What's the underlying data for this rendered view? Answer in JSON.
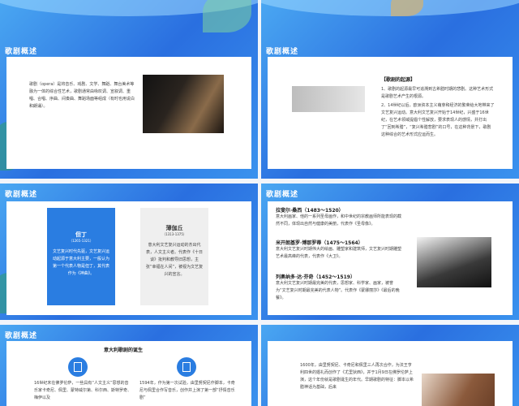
{
  "slides": {
    "s1": {
      "title": "歌剧概述",
      "text": "歌剧（opera）是将音乐、戏剧、文学、舞蹈、舞台美术等融为一体的综合性艺术，歌剧通常由咏叹调、宣叙调、重唱、合唱、序曲、间奏曲、舞蹈场面等组成（有时也用说白和朗诵）。"
    },
    "s2": {
      "title": "歌剧概述",
      "header": "【歌剧的起源】",
      "p1": "1、歌剧的起源最早可追溯到古希腊时期的悲剧。这种艺术形式是歌剧艺术产生的根源。",
      "p2": "2、14世纪以后，欧洲资本主义萌芽和经济的繁荣给大地带来了文艺复兴运动。意大利文艺复兴开始于14世纪，兴盛于16世纪，在艺术领域提倡个性解放，要求表现人的感情，并打出了“回到希腊”，“复兴希腊悲剧”的口号，在这种背景下，歌剧这种综合的艺术形式应运而生。"
    },
    "s3": {
      "title": "歌剧概述",
      "left_name": "但丁",
      "left_years": "（1265-1321）",
      "left_text": "文艺复兴时代先驱，文艺复兴运动起源于意大利主要，一般认为第一个代表人物是但丁，其代表作为《神曲》。",
      "right_name": "薄伽丘",
      "right_years": "（1313-1375）",
      "right_text": "意大利文艺复兴运动的杰出代表，人文主义者。代表作《十日谈》批判和教导旧思想，主张“幸福在人间”，被视为文艺复兴的宣言。"
    },
    "s4": {
      "title": "歌剧概述",
      "items": [
        {
          "head": "拉斐尔·桑西（1483～1520）",
          "text": "意大利画家、他的一系列圣母画作，和中世纪的宗教画师所能表现的截然不同，体现出自然与健康的美丽，代表作《圣母像》。"
        },
        {
          "head": "米开朗基罗·博那罗蒂（1475～1564）",
          "text": "意大利文艺复兴时期伟大的绘画、雕塑家和建筑师，文艺复兴时期雕塑艺术最高峰的代表，代表作《大卫》。"
        },
        {
          "head": "列奥纳多·达·芬奇（1452～1519）",
          "text": "意大利文艺复兴时期最完美的代表，思想家、科学家、画家，被誉为“文艺复兴时期最完美的代表人物”。代表作《蒙娜丽莎》《最后的晚餐》。"
        }
      ]
    },
    "s5": {
      "title": "歌剧概述",
      "subtitle": "意大利歌剧的诞生",
      "left_text": "16世纪末在佛罗伦萨，一些具有“人文主义”思想的音乐家卡奇尼、佩里、蒙特威尔第、科尔西、斯特罗奇、梅伊以及",
      "right_text": "1594年，作为第一次试验，由里努契尼作脚本，卡奇尼与佩里合作写音乐，创作并上演了第一部“抒情音乐剧”"
    },
    "s6": {
      "text": "1600年，由里努契尼、卡奇尼和佩里三人再次合作，为法王亨利四世的婚礼而创作了《尤里狄西》，并于1月9日在佛罗伦萨上演，这个年份就是歌剧诞生的年代。早期歌剧的特征：脚本以希腊神话为基础，后来"
    }
  },
  "colors": {
    "accent": "#2a7de1",
    "bg_blue": "#3a8ee8"
  }
}
